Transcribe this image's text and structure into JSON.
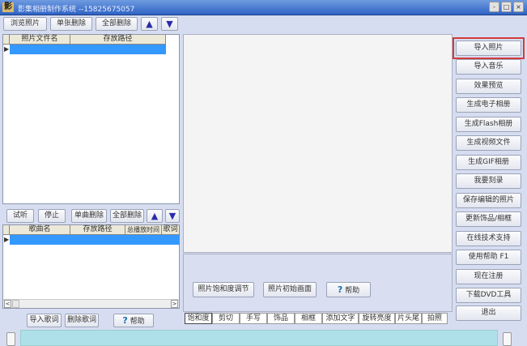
{
  "window": {
    "title": "影集相册制作系统 --15825675057",
    "logo": "影",
    "controls": [
      "-",
      "□",
      "×"
    ]
  },
  "photo_toolbar": {
    "browse": "浏览照片",
    "delete_one": "单张删除",
    "delete_all": "全部删除",
    "up": "▲",
    "down": "▼"
  },
  "photo_table": {
    "columns": [
      "照片文件名",
      "存放路径"
    ]
  },
  "music_toolbar": {
    "listen": "试听",
    "stop": "停止",
    "delete_one": "单曲删除",
    "delete_all": "全部删除",
    "up": "▲",
    "down": "▼"
  },
  "music_table": {
    "columns": [
      "歌曲名",
      "存放路径",
      "总播放时间",
      "歌词"
    ]
  },
  "lyrics": {
    "import": "导入歌词",
    "delete": "删除歌词",
    "help": "帮助"
  },
  "center": {
    "saturation": "照片饱和度调节",
    "initial": "照片初始画面",
    "help": "帮助"
  },
  "tabs": [
    "饱和度",
    "剪切",
    "手写",
    "饰品",
    "相框",
    "添加文字",
    "旋转亮度",
    "片头尾",
    "拍照"
  ],
  "right_buttons": [
    "导入照片",
    "导入音乐",
    "效果预览",
    "生成电子相册",
    "生成Flash相册",
    "生成视频文件",
    "生成GIF相册",
    "我要刻录",
    "保存编辑的照片",
    "更新饰品/相框",
    "在线技术支持",
    "使用帮助  F1",
    "现在注册",
    "下载DVD工具",
    "退出"
  ],
  "colors": {
    "highlight": "#d33b3b",
    "selection": "#3399ff"
  }
}
